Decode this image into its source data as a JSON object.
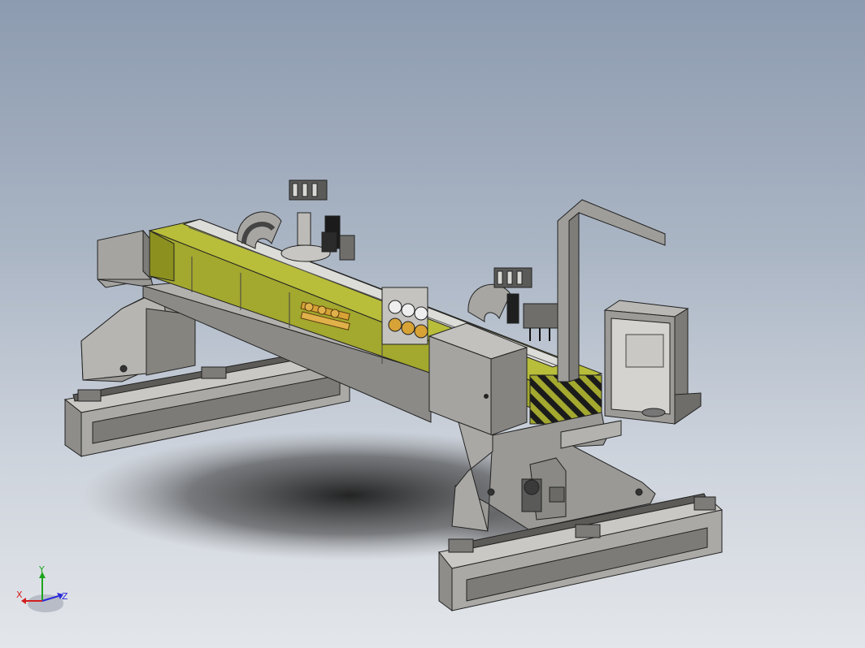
{
  "triad": {
    "x_label": "X",
    "y_label": "Y",
    "z_label": "Z",
    "x_color": "#d21e1e",
    "y_color": "#1fa31f",
    "z_color": "#2a2ad8"
  },
  "colors": {
    "background_top": "#8d9bb0",
    "background_bottom": "#e3e6ea",
    "steel": "#a3a29f",
    "steel_dark": "#6f6e6b",
    "beam_yellow": "#a3a82e",
    "copper": "#d7a236"
  }
}
